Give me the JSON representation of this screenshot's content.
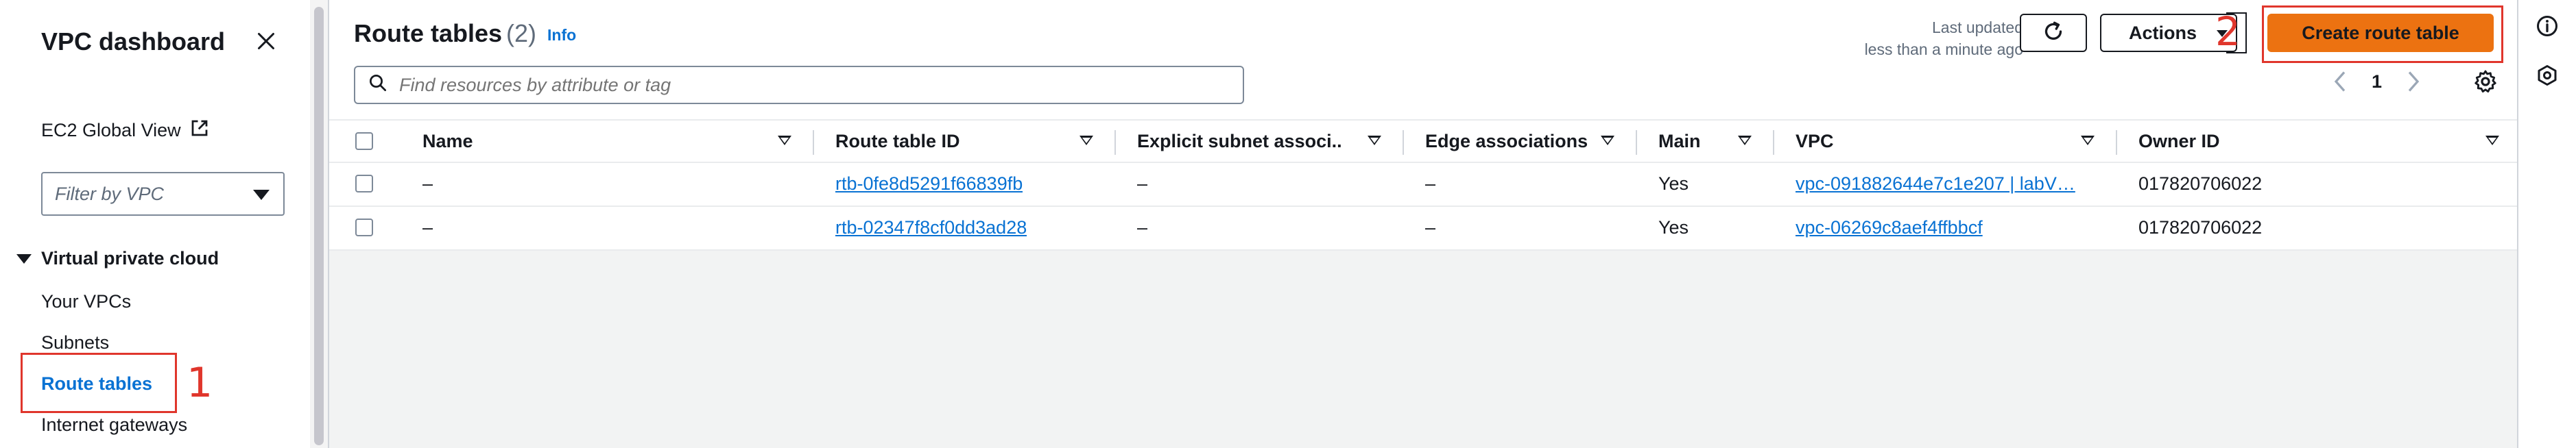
{
  "sidebar": {
    "title": "VPC dashboard",
    "ec2_link": "EC2 Global View",
    "filter_placeholder": "Filter by VPC",
    "section": "Virtual private cloud",
    "items": [
      {
        "label": "Your VPCs"
      },
      {
        "label": "Subnets"
      },
      {
        "label": "Route tables",
        "active": true
      },
      {
        "label": "Internet gateways"
      }
    ],
    "annotation": "1"
  },
  "header": {
    "title": "Route tables",
    "count": "(2)",
    "info": "Info",
    "last_updated_label": "Last updated",
    "last_updated_value": "less than a minute ago",
    "actions_label": "Actions",
    "create_label": "Create route table",
    "annotation": "2"
  },
  "search": {
    "placeholder": "Find resources by attribute or tag"
  },
  "pagination": {
    "page": "1"
  },
  "table": {
    "columns": [
      "Name",
      "Route table ID",
      "Explicit subnet associ...",
      "Edge associations",
      "Main",
      "VPC",
      "Owner ID"
    ],
    "rows": [
      {
        "name": "–",
        "route_table_id": "rtb-0fe8d5291f66839fb",
        "explicit_subnet": "–",
        "edge": "–",
        "main": "Yes",
        "vpc": "vpc-091882644e7c1e207 | labV…",
        "owner": "017820706022"
      },
      {
        "name": "–",
        "route_table_id": "rtb-02347f8cf0dd3ad28",
        "explicit_subnet": "–",
        "edge": "–",
        "main": "Yes",
        "vpc": "vpc-06269c8aef4ffbbcf",
        "owner": "017820706022"
      }
    ]
  },
  "colors": {
    "accent": "#0972d3",
    "primary_button": "#ec7211",
    "annotation": "#e0362c"
  },
  "icons": [
    "close-icon",
    "external-link-icon",
    "caret-down-icon",
    "refresh-icon",
    "search-icon",
    "chevron-left-icon",
    "chevron-right-icon",
    "settings-icon",
    "info-icon",
    "feedback-icon"
  ]
}
